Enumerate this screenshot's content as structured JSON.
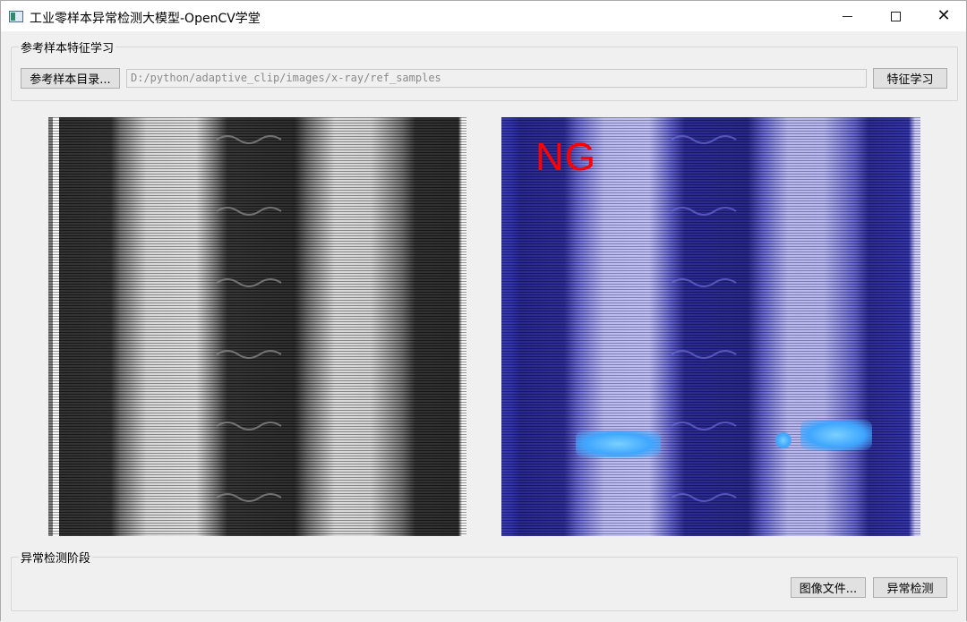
{
  "window": {
    "title": "工业零样本异常检测大模型-OpenCV学堂",
    "minimize": "—",
    "maximize": "□",
    "close": "✕"
  },
  "reference_group": {
    "title": "参考样本特征学习",
    "dir_button": "参考样本目录...",
    "path_value": "D:/python/adaptive_clip/images/x-ray/ref_samples",
    "learn_button": "特征学习"
  },
  "viewer": {
    "left_image": "x-ray-reference-image",
    "right_image": "anomaly-heatmap-overlay",
    "result_label": "NG"
  },
  "detect_group": {
    "title": "异常检测阶段",
    "file_button": "图像文件...",
    "detect_button": "异常检测"
  },
  "colors": {
    "result_ng": "#ff0000",
    "heatmap_base": "#24248c",
    "anomaly_highlight": "#3fa6ff"
  }
}
